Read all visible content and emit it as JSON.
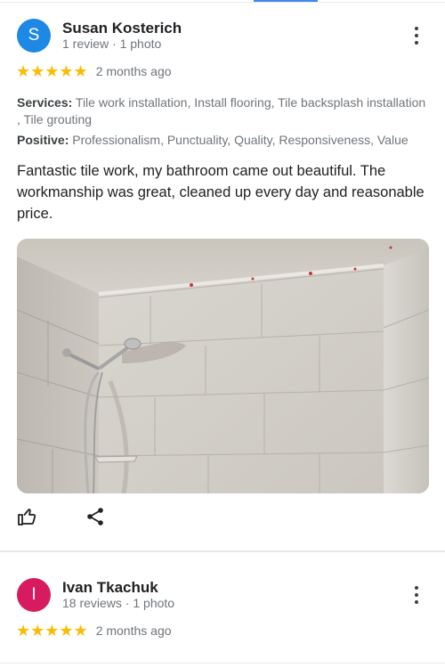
{
  "reviews": [
    {
      "avatar_letter": "S",
      "avatar_color": "#1e88e5",
      "author": "Susan Kosterich",
      "meta": "1 review · 1 photo",
      "stars": "★★★★★",
      "rating": 5,
      "date": "2 months ago",
      "services_label": "Services:",
      "services_value": " Tile work installation, Install flooring, Tile backsplash installation , Tile grouting",
      "positive_label": "Positive:",
      "positive_value": " Professionalism, Punctuality, Quality, Responsiveness, Value",
      "text": "Fantastic tile work, my bathroom came out beautiful. The workmanship was great, cleaned up every day and reasonable price."
    },
    {
      "avatar_letter": "I",
      "avatar_color": "#d81b60",
      "author": "Ivan Tkachuk",
      "meta": "18 reviews · 1 photo",
      "stars": "★★★★★",
      "rating": 5,
      "date": "2 months ago"
    }
  ],
  "icons": {
    "more": "more-vert-icon",
    "like": "thumb-up-icon",
    "share": "share-icon"
  },
  "colors": {
    "star": "#fbbc04",
    "accent": "#4285f4"
  }
}
